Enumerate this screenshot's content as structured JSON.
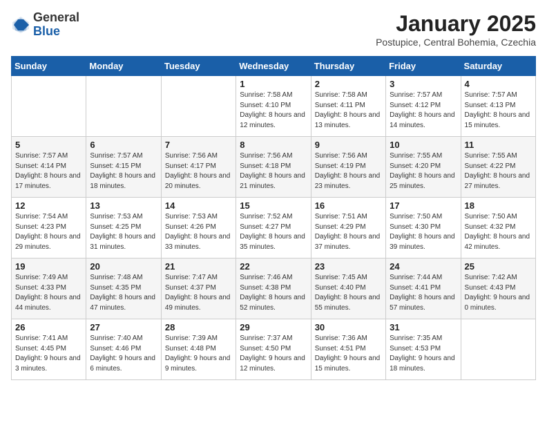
{
  "header": {
    "logo_general": "General",
    "logo_blue": "Blue",
    "month_title": "January 2025",
    "location": "Postupice, Central Bohemia, Czechia"
  },
  "weekdays": [
    "Sunday",
    "Monday",
    "Tuesday",
    "Wednesday",
    "Thursday",
    "Friday",
    "Saturday"
  ],
  "weeks": [
    [
      {
        "day": "",
        "detail": ""
      },
      {
        "day": "",
        "detail": ""
      },
      {
        "day": "",
        "detail": ""
      },
      {
        "day": "1",
        "detail": "Sunrise: 7:58 AM\nSunset: 4:10 PM\nDaylight: 8 hours\nand 12 minutes."
      },
      {
        "day": "2",
        "detail": "Sunrise: 7:58 AM\nSunset: 4:11 PM\nDaylight: 8 hours\nand 13 minutes."
      },
      {
        "day": "3",
        "detail": "Sunrise: 7:57 AM\nSunset: 4:12 PM\nDaylight: 8 hours\nand 14 minutes."
      },
      {
        "day": "4",
        "detail": "Sunrise: 7:57 AM\nSunset: 4:13 PM\nDaylight: 8 hours\nand 15 minutes."
      }
    ],
    [
      {
        "day": "5",
        "detail": "Sunrise: 7:57 AM\nSunset: 4:14 PM\nDaylight: 8 hours\nand 17 minutes."
      },
      {
        "day": "6",
        "detail": "Sunrise: 7:57 AM\nSunset: 4:15 PM\nDaylight: 8 hours\nand 18 minutes."
      },
      {
        "day": "7",
        "detail": "Sunrise: 7:56 AM\nSunset: 4:17 PM\nDaylight: 8 hours\nand 20 minutes."
      },
      {
        "day": "8",
        "detail": "Sunrise: 7:56 AM\nSunset: 4:18 PM\nDaylight: 8 hours\nand 21 minutes."
      },
      {
        "day": "9",
        "detail": "Sunrise: 7:56 AM\nSunset: 4:19 PM\nDaylight: 8 hours\nand 23 minutes."
      },
      {
        "day": "10",
        "detail": "Sunrise: 7:55 AM\nSunset: 4:20 PM\nDaylight: 8 hours\nand 25 minutes."
      },
      {
        "day": "11",
        "detail": "Sunrise: 7:55 AM\nSunset: 4:22 PM\nDaylight: 8 hours\nand 27 minutes."
      }
    ],
    [
      {
        "day": "12",
        "detail": "Sunrise: 7:54 AM\nSunset: 4:23 PM\nDaylight: 8 hours\nand 29 minutes."
      },
      {
        "day": "13",
        "detail": "Sunrise: 7:53 AM\nSunset: 4:25 PM\nDaylight: 8 hours\nand 31 minutes."
      },
      {
        "day": "14",
        "detail": "Sunrise: 7:53 AM\nSunset: 4:26 PM\nDaylight: 8 hours\nand 33 minutes."
      },
      {
        "day": "15",
        "detail": "Sunrise: 7:52 AM\nSunset: 4:27 PM\nDaylight: 8 hours\nand 35 minutes."
      },
      {
        "day": "16",
        "detail": "Sunrise: 7:51 AM\nSunset: 4:29 PM\nDaylight: 8 hours\nand 37 minutes."
      },
      {
        "day": "17",
        "detail": "Sunrise: 7:50 AM\nSunset: 4:30 PM\nDaylight: 8 hours\nand 39 minutes."
      },
      {
        "day": "18",
        "detail": "Sunrise: 7:50 AM\nSunset: 4:32 PM\nDaylight: 8 hours\nand 42 minutes."
      }
    ],
    [
      {
        "day": "19",
        "detail": "Sunrise: 7:49 AM\nSunset: 4:33 PM\nDaylight: 8 hours\nand 44 minutes."
      },
      {
        "day": "20",
        "detail": "Sunrise: 7:48 AM\nSunset: 4:35 PM\nDaylight: 8 hours\nand 47 minutes."
      },
      {
        "day": "21",
        "detail": "Sunrise: 7:47 AM\nSunset: 4:37 PM\nDaylight: 8 hours\nand 49 minutes."
      },
      {
        "day": "22",
        "detail": "Sunrise: 7:46 AM\nSunset: 4:38 PM\nDaylight: 8 hours\nand 52 minutes."
      },
      {
        "day": "23",
        "detail": "Sunrise: 7:45 AM\nSunset: 4:40 PM\nDaylight: 8 hours\nand 55 minutes."
      },
      {
        "day": "24",
        "detail": "Sunrise: 7:44 AM\nSunset: 4:41 PM\nDaylight: 8 hours\nand 57 minutes."
      },
      {
        "day": "25",
        "detail": "Sunrise: 7:42 AM\nSunset: 4:43 PM\nDaylight: 9 hours\nand 0 minutes."
      }
    ],
    [
      {
        "day": "26",
        "detail": "Sunrise: 7:41 AM\nSunset: 4:45 PM\nDaylight: 9 hours\nand 3 minutes."
      },
      {
        "day": "27",
        "detail": "Sunrise: 7:40 AM\nSunset: 4:46 PM\nDaylight: 9 hours\nand 6 minutes."
      },
      {
        "day": "28",
        "detail": "Sunrise: 7:39 AM\nSunset: 4:48 PM\nDaylight: 9 hours\nand 9 minutes."
      },
      {
        "day": "29",
        "detail": "Sunrise: 7:37 AM\nSunset: 4:50 PM\nDaylight: 9 hours\nand 12 minutes."
      },
      {
        "day": "30",
        "detail": "Sunrise: 7:36 AM\nSunset: 4:51 PM\nDaylight: 9 hours\nand 15 minutes."
      },
      {
        "day": "31",
        "detail": "Sunrise: 7:35 AM\nSunset: 4:53 PM\nDaylight: 9 hours\nand 18 minutes."
      },
      {
        "day": "",
        "detail": ""
      }
    ]
  ]
}
